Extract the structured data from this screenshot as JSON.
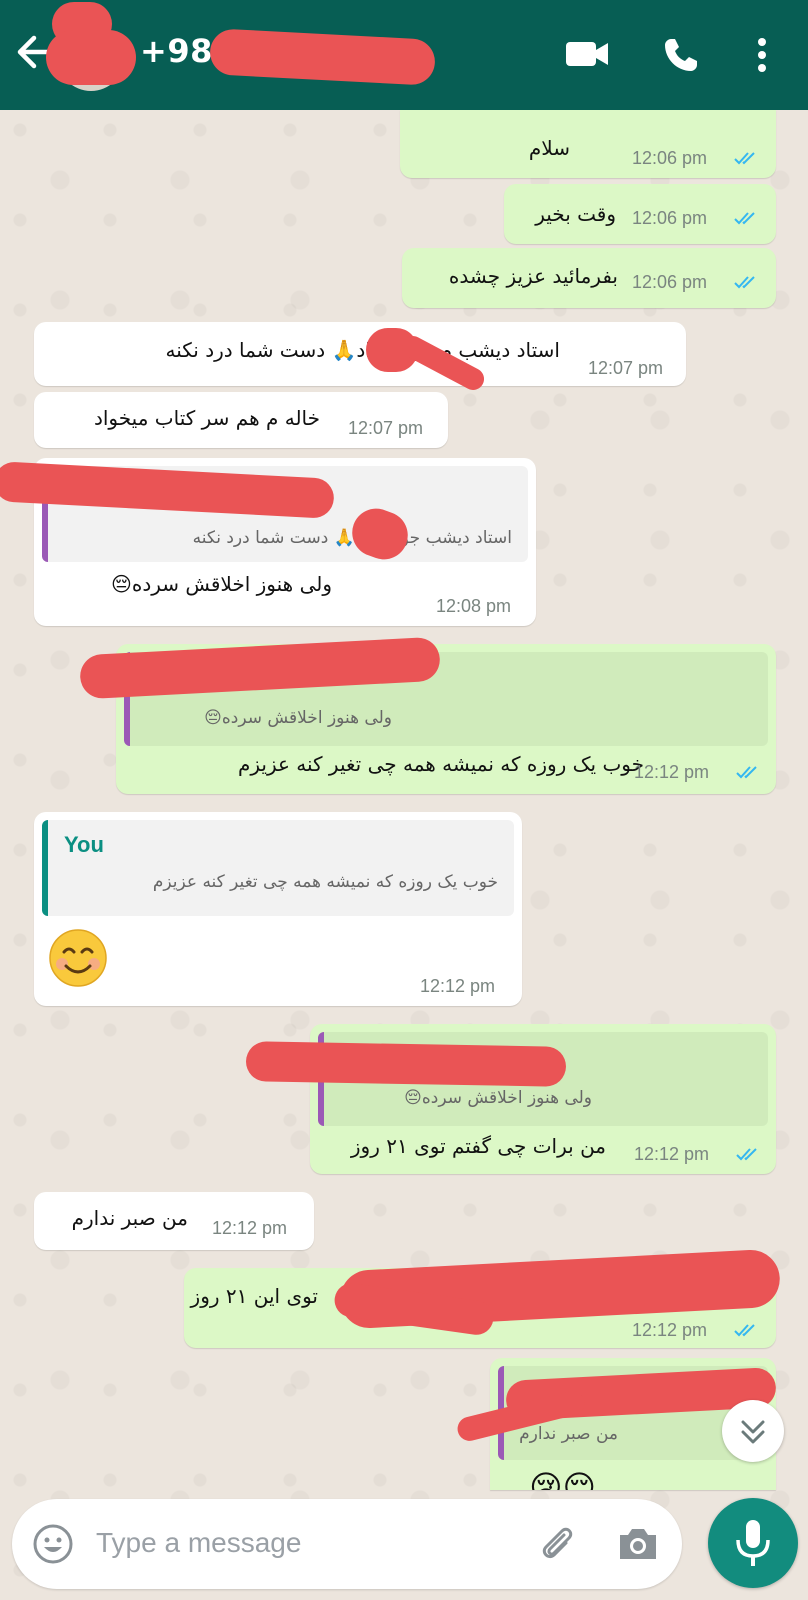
{
  "header": {
    "contact_prefix": "+98",
    "icons": [
      "back-arrow-icon",
      "video-call-icon",
      "phone-icon",
      "more-vert-icon"
    ]
  },
  "colors": {
    "header": "#075e54",
    "outgoing_bubble": "#dcf8c6",
    "incoming_bubble": "#ffffff",
    "read_ticks": "#34b7f1",
    "redaction": "#ea5455",
    "quote_bar_purple": "#9b59b6",
    "quote_bar_teal": "#0b8f82",
    "mic_button": "#128c7e"
  },
  "messages": [
    {
      "dir": "out",
      "text": "سلام",
      "time": "12:06 pm",
      "read": true
    },
    {
      "dir": "out",
      "text": "وقت بخیر",
      "time": "12:06 pm",
      "read": true
    },
    {
      "dir": "out",
      "text": "بفرمائید عزیز چشده",
      "time": "12:06 pm",
      "read": true
    },
    {
      "dir": "in",
      "text": "استاد دیشب م   جوابم داد🙏 دست شما درد نکنه",
      "time": "12:07 pm"
    },
    {
      "dir": "in",
      "text": "خاله م هم سر کتاب میخواد",
      "time": "12:07 pm"
    },
    {
      "dir": "in",
      "quote": "استاد دیشب    جوابم داد🙏 دست شما درد نکنه",
      "text": "ولی هنوز اخلاقش سرده😔",
      "time": "12:08 pm"
    },
    {
      "dir": "out",
      "quote": "ولی هنوز اخلاقش سرده😔",
      "text": "خوب یک روزه که نمیشه همه چی تغیر کنه  عزیزم",
      "time": "12:12 pm",
      "read": true
    },
    {
      "dir": "in",
      "quote_author": "You",
      "quote": "خوب یک روزه که نمیشه همه چی تغیر کنه  عزیزم",
      "text": "😊",
      "time": "12:12 pm"
    },
    {
      "dir": "out",
      "quote": "ولی هنوز اخلاقش سرده😔",
      "text": "من برات چی گفتم توی ۲۱ روز",
      "time": "12:12 pm",
      "read": true
    },
    {
      "dir": "in",
      "text": "من صبر ندارم",
      "time": "12:12 pm"
    },
    {
      "dir": "out",
      "text": "توی این ۲۱ روز",
      "time": "12:12 pm",
      "read": true
    },
    {
      "dir": "out",
      "quote": "من صبر ندارم",
      "text": "😔😢"
    }
  ],
  "composer": {
    "placeholder": "Type a message",
    "icons": [
      "emoji-icon",
      "attach-icon",
      "camera-icon",
      "mic-icon"
    ]
  }
}
